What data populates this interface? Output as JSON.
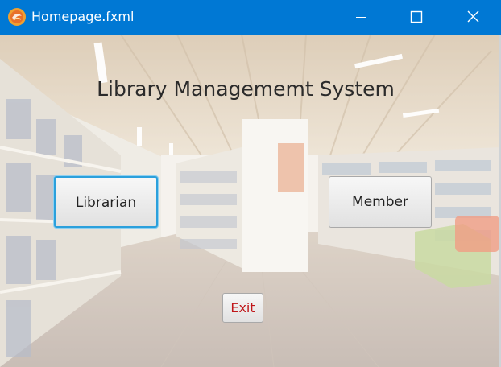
{
  "window": {
    "title": "Homepage.fxml",
    "app_icon": "javafx-app-icon",
    "controls": [
      "minimize-icon",
      "maximize-icon",
      "close-icon"
    ],
    "titlebar_color": "#0078d4"
  },
  "main": {
    "heading": "Library Managememt System",
    "background": "library-bookshelves-photo",
    "buttons": {
      "librarian": "Librarian",
      "member": "Member",
      "exit": "Exit"
    },
    "focused_button": "librarian",
    "colors": {
      "focus_ring": "#2ba0dc",
      "exit_text": "#c0161a"
    }
  }
}
